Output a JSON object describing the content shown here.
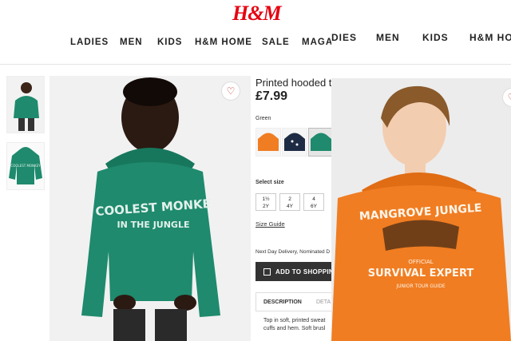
{
  "header": {
    "logo": "H&M",
    "nav": [
      "LADIES",
      "MEN",
      "KIDS",
      "H&M HOME",
      "SALE",
      "MAGAZ"
    ]
  },
  "product": {
    "title": "Printed hooded t",
    "price": "£7.99",
    "color_label": "Green",
    "select_size_label": "Select size",
    "sizes": [
      {
        "line1": "1½",
        "line2": "2Y"
      },
      {
        "line1": "2",
        "line2": "4Y"
      },
      {
        "line1": "4",
        "line2": "6Y"
      }
    ],
    "size_guide": "Size Guide",
    "delivery": "Next Day Delivery, Nominated D",
    "add_button": "ADD TO SHOPPIN",
    "tabs": [
      "DESCRIPTION",
      "DETA"
    ],
    "description": "Top in soft, printed sweat",
    "description2": "cuffs and hem. Soft brusl",
    "main_print_line1": "COOLEST MONKE",
    "main_print_line2": "IN THE JUNGLE",
    "thumb_print": "COOLEST MONKEY"
  },
  "overlay": {
    "nav": [
      "DIES",
      "MEN",
      "KIDS",
      "H&M HO"
    ],
    "print_line1": "MANGROVE JUNGLE",
    "print_line2": "OFFICIAL",
    "print_line3": "SURVIVAL EXPERT",
    "print_line4": "JUNIOR TOUR GUIDE"
  },
  "colors": {
    "brand": "#e50010",
    "hoodie_green": "#1f8a6d",
    "hoodie_orange": "#f07d22"
  }
}
